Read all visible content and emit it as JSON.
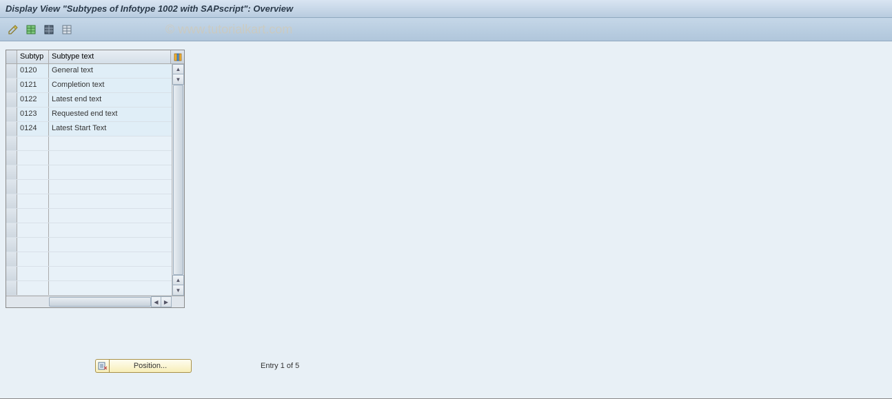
{
  "title": "Display View \"Subtypes of Infotype 1002 with SAPscript\": Overview",
  "watermark": "© www.tutorialkart.com",
  "table": {
    "headers": {
      "subtyp": "Subtyp",
      "text": "Subtype text"
    },
    "rows": [
      {
        "subtyp": "0120",
        "text": "General text"
      },
      {
        "subtyp": "0121",
        "text": "Completion text"
      },
      {
        "subtyp": "0122",
        "text": "Latest end text"
      },
      {
        "subtyp": "0123",
        "text": "Requested end text"
      },
      {
        "subtyp": "0124",
        "text": "Latest Start Text"
      }
    ],
    "empty_rows": 11
  },
  "footer": {
    "position_label": "Position...",
    "entry_label": "Entry 1 of 5"
  },
  "toolbar": {
    "icons": [
      "change-icon",
      "select-all-icon",
      "table-settings-icon",
      "table-view-icon"
    ]
  }
}
